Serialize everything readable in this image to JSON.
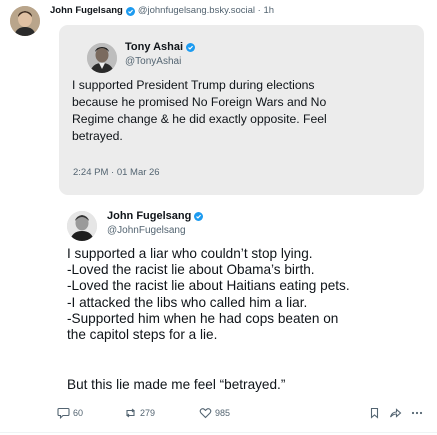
{
  "post": {
    "author_name": "John Fugelsang",
    "author_meta": "@johnfugelsang.bsky.social · 1h"
  },
  "quote1": {
    "name": "Tony Ashai",
    "handle": "@TonyAshai",
    "lines": [
      "I supported President Trump during elections",
      "because he promised No Foreign Wars and No",
      "Regime change & he did exactly opposite. Feel",
      "betrayed."
    ],
    "time": "2:24 PM · 01 Mar 26"
  },
  "quote2": {
    "name": "John Fugelsang",
    "handle": "@JohnFugelsang",
    "lines": [
      "I supported a liar who couldn’t stop lying.",
      "-Loved the racist lie about Obama’s birth.",
      "-Loved the racist lie about Haitians eating pets.",
      "-I attacked the libs who called him a liar.",
      "-Supported him when he had cops beaten on",
      "the capitol steps for a lie."
    ],
    "closing": "But this lie made me feel “betrayed.”"
  },
  "actions": {
    "replies": "60",
    "reposts": "279",
    "likes": "985"
  },
  "colors": {
    "verified_blue": "#1d9bf0",
    "muted_text": "#536471",
    "quote_card_bg": "#ececec"
  },
  "icons": [
    "verified-badge-icon",
    "reply-icon",
    "repost-icon",
    "like-icon",
    "bookmark-icon",
    "share-icon",
    "more-icon"
  ]
}
